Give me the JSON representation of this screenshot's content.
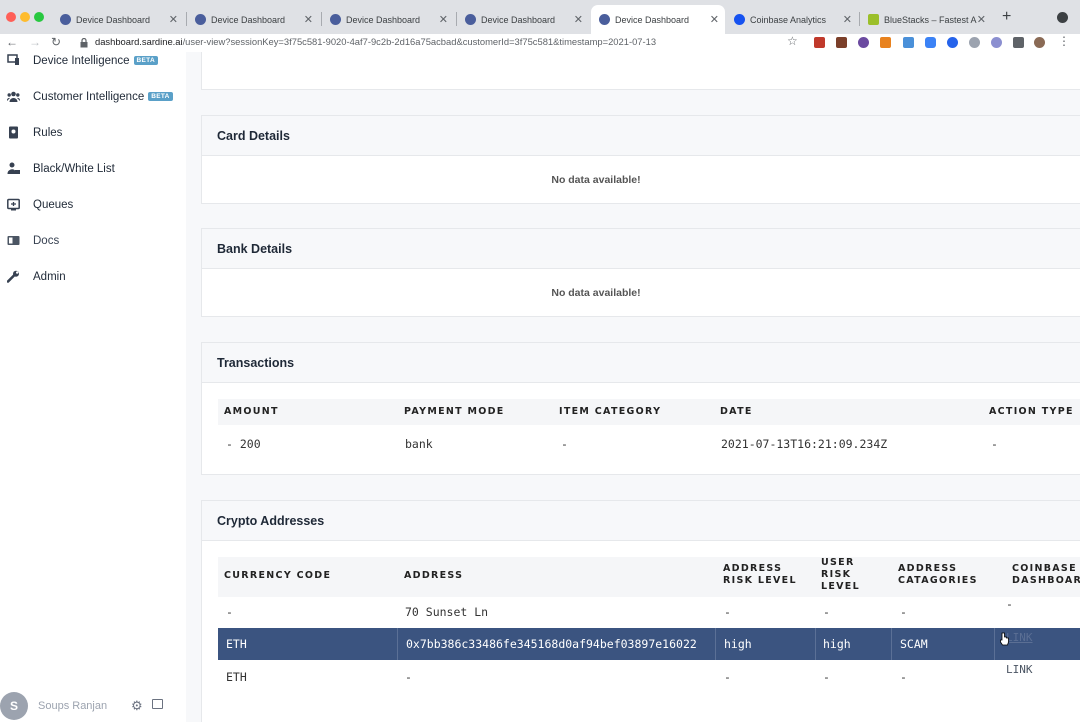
{
  "browser": {
    "tabs": [
      {
        "title": "Device Dashboard",
        "active": false
      },
      {
        "title": "Device Dashboard",
        "active": false
      },
      {
        "title": "Device Dashboard",
        "active": false
      },
      {
        "title": "Device Dashboard",
        "active": false
      },
      {
        "title": "Device Dashboard",
        "active": true
      },
      {
        "title": "Coinbase Analytics",
        "active": false
      },
      {
        "title": "BlueStacks – Fastest A",
        "active": false
      }
    ],
    "url_host": "dashboard.sardine.ai",
    "url_path": "/user-view?sessionKey=3f75c581-9020-4af7-9c2b-2d16a75acbad&customerId=3f75c581&timestamp=2021-07-13"
  },
  "sidebar": {
    "items": [
      {
        "label": "Device Intelligence",
        "badge": "BETA"
      },
      {
        "label": "Customer Intelligence",
        "badge": "BETA"
      },
      {
        "label": "Rules"
      },
      {
        "label": "Black/White List"
      },
      {
        "label": "Queues"
      },
      {
        "label": "Docs"
      },
      {
        "label": "Admin"
      }
    ],
    "user": {
      "initial": "S",
      "name": "Soups Ranjan"
    }
  },
  "cards": {
    "card_details": {
      "title": "Card Details",
      "empty": "No data available!"
    },
    "bank_details": {
      "title": "Bank Details",
      "empty": "No data available!"
    },
    "transactions": {
      "title": "Transactions",
      "headers": [
        "AMOUNT",
        "PAYMENT MODE",
        "ITEM CATEGORY",
        "DATE",
        "ACTION TYPE"
      ],
      "rows": [
        [
          "- 200",
          "bank",
          "-",
          "2021-07-13T16:21:09.234Z",
          "-"
        ]
      ]
    },
    "crypto": {
      "title": "Crypto Addresses",
      "headers": [
        "CURRENCY CODE",
        "ADDRESS",
        "ADDRESS RISK LEVEL",
        "USER RISK LEVEL",
        "ADDRESS CATAGORIES",
        "COINBASE DASHBOARD"
      ],
      "rows": [
        [
          "-",
          "70 Sunset Ln",
          "-",
          "-",
          "-",
          "-"
        ],
        [
          "ETH",
          "0x7bb386c33486fe345168d0af94bef03897e16022",
          "high",
          "high",
          "SCAM",
          "LINK"
        ],
        [
          "ETH",
          "-",
          "-",
          "-",
          "-",
          "LINK"
        ]
      ]
    }
  },
  "colors": {
    "selected_row": "#3b5480",
    "beta_badge": "#5aa0c8"
  }
}
